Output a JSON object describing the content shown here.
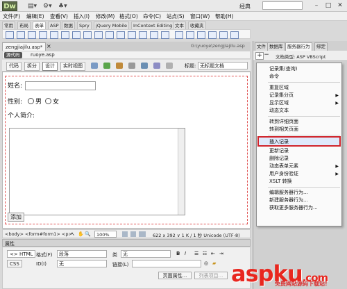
{
  "app": {
    "logo": "Dw",
    "preset": "经典",
    "menus": [
      "文件(F)",
      "编辑(E)",
      "查看(V)",
      "插入(I)",
      "修改(M)",
      "格式(O)",
      "命令(C)",
      "站点(S)",
      "窗口(W)",
      "帮助(H)"
    ]
  },
  "insert_tabs": [
    "常用",
    "布局",
    "表单",
    "ASP",
    "数据",
    "Spry",
    "jQuery Mobile",
    "InContext Editing",
    "文本",
    "收藏夹"
  ],
  "doc": {
    "tab_active": "zengjiajilu.asp*",
    "tab_close": "×",
    "path": "G:\\yuoye\\zengjiajilu.asp",
    "source_badge": "源代码",
    "source_file": "ruoye.asp",
    "views": [
      "代码",
      "拆分",
      "设计",
      "实时视图"
    ],
    "title_label": "标题:",
    "title_value": "无标题文档"
  },
  "form": {
    "name_label": "姓名:",
    "gender_label": "性别:",
    "male": "男",
    "female": "女",
    "intro_label": "个人简介:",
    "submit": "添加"
  },
  "status": {
    "tagpath": "<body> <form#form1> <p>",
    "zoom": "100%",
    "dims": "622 x 392 ∨ 1 K / 1 秒  Unicode (UTF-8)"
  },
  "props": {
    "title": "属性",
    "html_btn": "<> HTML",
    "css_btn": "CSS",
    "format_label": "格式(F)",
    "format_value": "段落",
    "class_label": "类",
    "class_value": "无",
    "id_label": "ID(I)",
    "id_value": "无",
    "link_label": "链接(L)",
    "page_props": "页面属性...",
    "list_item": "列表项目...",
    "bold": "B",
    "italic": "I"
  },
  "right_panel": {
    "tabs": [
      "文件",
      "数据库",
      "服务器行为",
      "绑定"
    ],
    "doctype": "文档类型: ASP VBScript"
  },
  "context_menu": {
    "items": [
      {
        "label": "记录集(查询)",
        "arrow": false
      },
      {
        "label": "命令",
        "arrow": false
      },
      {
        "sep": true
      },
      {
        "label": "重复区域",
        "arrow": false
      },
      {
        "label": "记录集分页",
        "arrow": true
      },
      {
        "label": "显示区域",
        "arrow": true
      },
      {
        "label": "动态文本",
        "arrow": false
      },
      {
        "sep": true
      },
      {
        "label": "转到详细页面",
        "arrow": false
      },
      {
        "label": "转到相关页面",
        "arrow": false
      },
      {
        "sep": true
      },
      {
        "label": "插入记录",
        "arrow": false,
        "highlight": true
      },
      {
        "label": "更新记录",
        "arrow": false
      },
      {
        "label": "删除记录",
        "arrow": false
      },
      {
        "label": "动态表单元素",
        "arrow": true
      },
      {
        "label": "用户身份验证",
        "arrow": true
      },
      {
        "label": "XSLT 转换",
        "arrow": false
      },
      {
        "sep": true
      },
      {
        "label": "编辑服务器行为...",
        "arrow": false
      },
      {
        "label": "新建服务器行为...",
        "arrow": false
      },
      {
        "label": "获取更多服务器行为...",
        "arrow": false
      }
    ]
  },
  "watermark": {
    "main": "aspku",
    "tld": ".com",
    "sub": "免费网站源码下载站!"
  },
  "colors": {
    "highlight_border": "#d0242b",
    "watermark": "#e8271f",
    "logo_bg": "#5c6b48"
  }
}
